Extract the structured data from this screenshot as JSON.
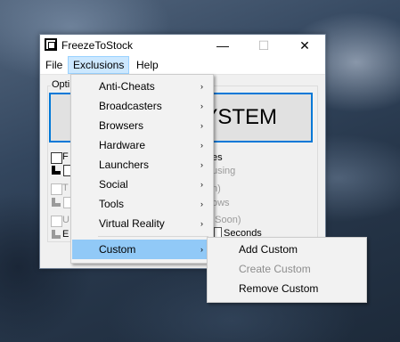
{
  "window": {
    "title": "FreezeToStock",
    "minimize_glyph": "—",
    "maximize_glyph": "☐",
    "close_glyph": "✕"
  },
  "menubar": [
    "File",
    "Exclusions",
    "Help"
  ],
  "options_group": {
    "label_partial": "Opti",
    "big_button_text": "YSTEM"
  },
  "background_texts": {
    "r1_left": "F",
    "r1_right": "es",
    "r2_right": "using",
    "r3_left": "T",
    "r3_right": "n)",
    "r4_right": "ows",
    "r5_left": "U",
    "r5_right": "g Soon)",
    "r6_left": "E",
    "r6_seconds": "Seconds"
  },
  "exclusions_menu": {
    "items": [
      {
        "label": "Anti-Cheats",
        "arrow": "›"
      },
      {
        "label": "Broadcasters",
        "arrow": "›"
      },
      {
        "label": "Browsers",
        "arrow": "›"
      },
      {
        "label": "Hardware",
        "arrow": "›"
      },
      {
        "label": "Launchers",
        "arrow": "›"
      },
      {
        "label": "Social",
        "arrow": "›"
      },
      {
        "label": "Tools",
        "arrow": "›"
      },
      {
        "label": "Virtual Reality",
        "arrow": "›"
      }
    ],
    "custom": {
      "label": "Custom",
      "arrow": "›"
    }
  },
  "custom_submenu": {
    "items": [
      {
        "label": "Add Custom",
        "enabled": true
      },
      {
        "label": "Create Custom",
        "enabled": false
      },
      {
        "label": "Remove Custom",
        "enabled": true
      }
    ]
  },
  "colors": {
    "menu_highlight": "#91c9f7",
    "active_menubar": "#cce8ff",
    "button_focus_border": "#0078d7"
  }
}
